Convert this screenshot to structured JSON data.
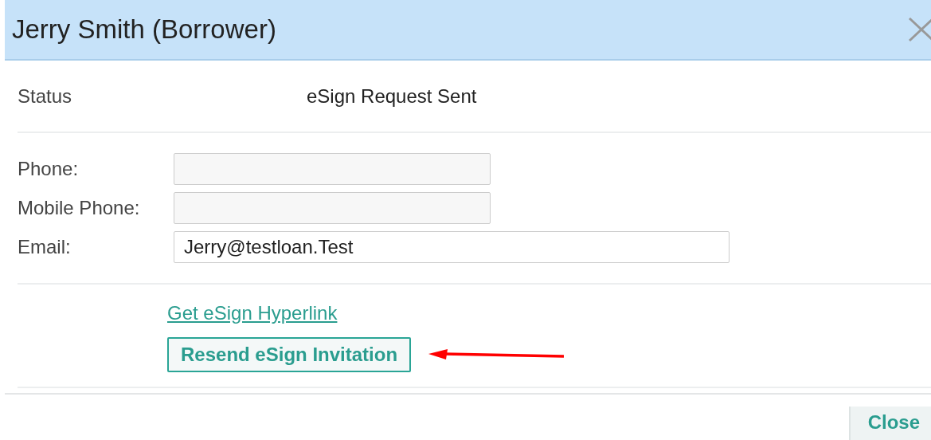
{
  "dialog": {
    "title": "Jerry Smith (Borrower)"
  },
  "status": {
    "label": "Status",
    "value": "eSign Request Sent"
  },
  "fields": [
    {
      "label": "Phone:",
      "disabled": true
    },
    {
      "label": "Mobile Phone:",
      "disabled": true
    },
    {
      "label": "Email:",
      "value": "Jerry@testloan.Test",
      "disabled": false
    }
  ],
  "link": "Get eSign Hyperlink",
  "resend_button": "Resend eSign Invitation",
  "footer": {
    "close_button": "Close"
  }
}
